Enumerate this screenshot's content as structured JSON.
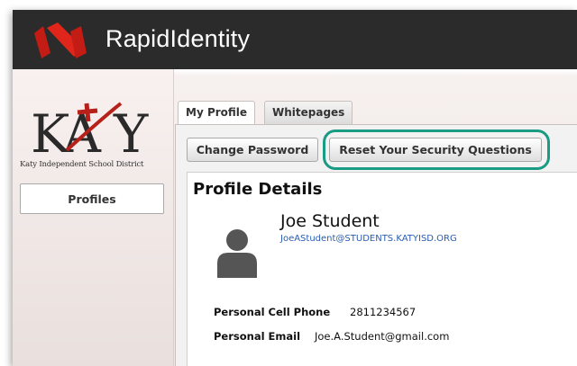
{
  "app": {
    "title": "RapidIdentity",
    "icon": "rapididentity-logo-icon",
    "brand_color": "#e0261b",
    "topbar_color": "#2b2b2b"
  },
  "sidebar": {
    "logo_text": "KATY",
    "district_name": "Katy Independent School District",
    "nav": [
      {
        "label": "Profiles"
      }
    ]
  },
  "tabs": [
    {
      "label": "My Profile",
      "active": true
    },
    {
      "label": "Whitepages",
      "active": false
    }
  ],
  "toolbar": {
    "change_password_label": "Change Password",
    "reset_questions_label": "Reset Your Security Questions",
    "highlight_color": "#1a9b83"
  },
  "profile": {
    "heading": "Profile Details",
    "name": "Joe Student",
    "email": "JoeAStudent@STUDENTS.KATYISD.ORG",
    "avatar_icon": "person-silhouette-icon",
    "fields": [
      {
        "label": "Personal Cell Phone",
        "value": "2811234567"
      },
      {
        "label": "Personal Email",
        "value": "Joe.A.Student@gmail.com"
      }
    ]
  }
}
